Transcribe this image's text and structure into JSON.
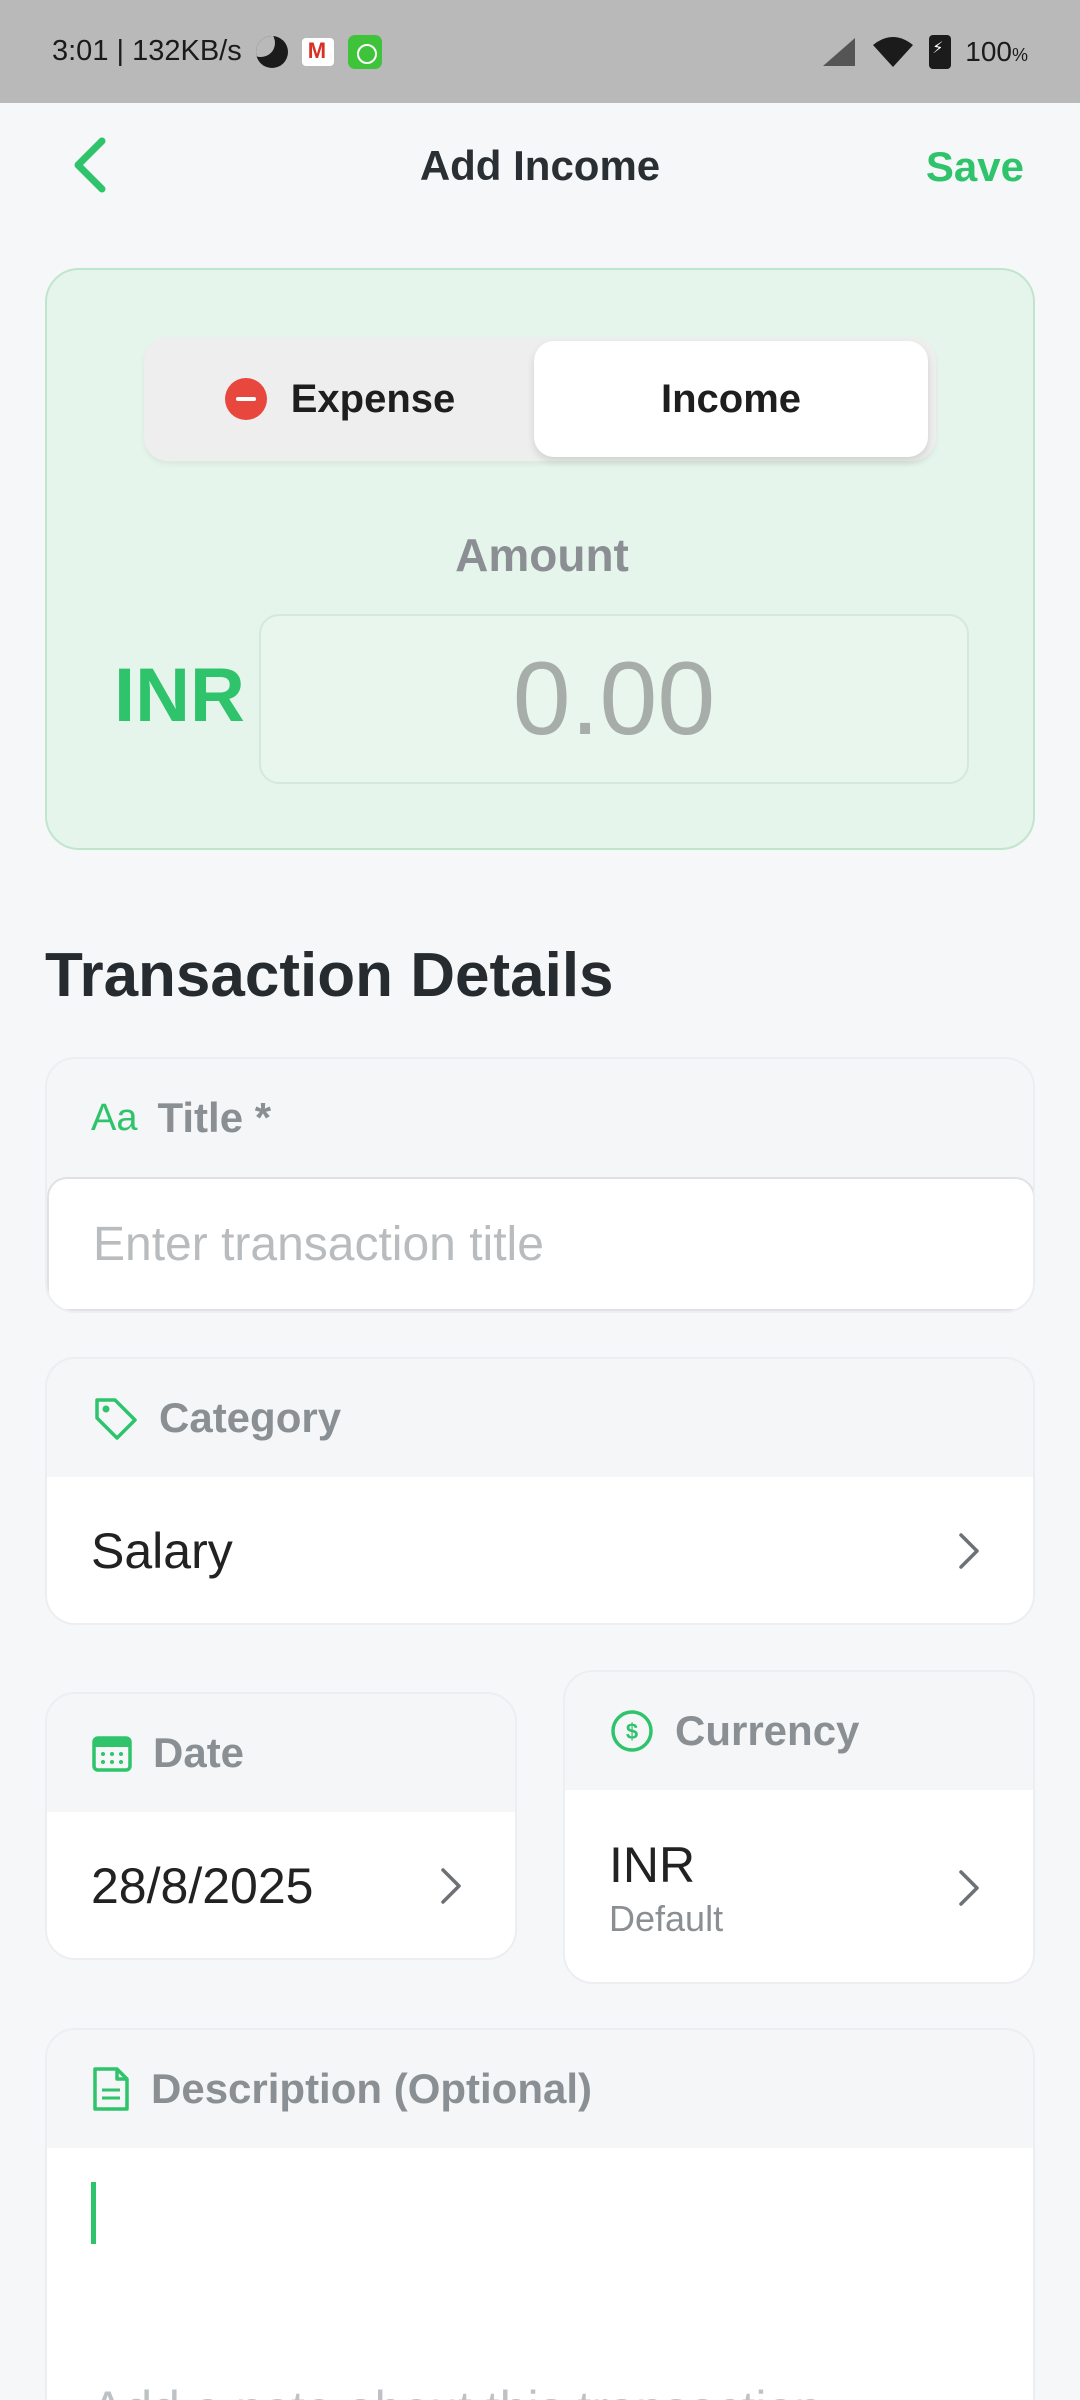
{
  "status_bar": {
    "time_speed": "3:01 | 132KB/s",
    "battery": "100",
    "battery_unit": "%"
  },
  "header": {
    "title": "Add Income",
    "save_label": "Save"
  },
  "type_toggle": {
    "expense_label": "Expense",
    "income_label": "Income",
    "selected": "Income"
  },
  "amount": {
    "label": "Amount",
    "currency": "INR",
    "placeholder": "0.00"
  },
  "section_title": "Transaction Details",
  "title_field": {
    "icon_text": "Aa",
    "label": "Title *",
    "placeholder": "Enter transaction title"
  },
  "category_field": {
    "label": "Category",
    "value": "Salary"
  },
  "date_field": {
    "label": "Date",
    "value": "28/8/2025"
  },
  "currency_field": {
    "label": "Currency",
    "value": "INR",
    "sub": "Default"
  },
  "description_field": {
    "label": "Description (Optional)",
    "placeholder": "Add a note about this transaction..."
  },
  "colors": {
    "accent": "#2fc36b",
    "expense_red": "#e7473c"
  }
}
